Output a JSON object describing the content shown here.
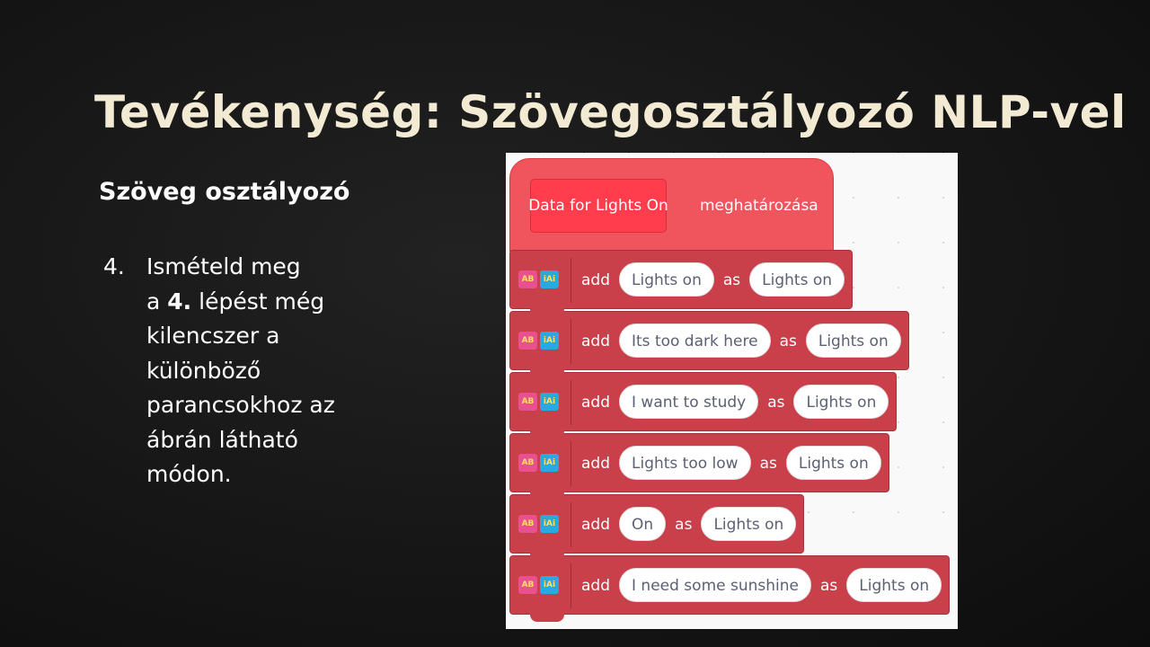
{
  "slide": {
    "title": "Tevékenység: Szövegosztályozó NLP-vel",
    "subtitle": "Szöveg osztályozó",
    "step_number": "4.",
    "step_lines": [
      "Ismételd meg",
      "a ",
      "4.",
      " lépést  még",
      "kilencszer a",
      "különböző",
      "parancsokhoz az",
      "ábrán látható",
      "módon."
    ]
  },
  "blocks": {
    "hat": {
      "data_label": "Data for Lights On",
      "text": "meghatározása"
    },
    "icon_labels": {
      "icon1": "AB",
      "icon2": "iAi"
    },
    "add_label": "add",
    "as_label": "as",
    "rows": [
      {
        "text": "Lights on",
        "class": "Lights on"
      },
      {
        "text": "Its too dark here",
        "class": "Lights on"
      },
      {
        "text": "I want to study",
        "class": "Lights on"
      },
      {
        "text": "Lights too low",
        "class": "Lights on"
      },
      {
        "text": "On",
        "class": "Lights on"
      },
      {
        "text": "I need some sunshine",
        "class": "Lights on"
      }
    ]
  },
  "colors": {
    "title": "#f2ead3",
    "hat_block": "#f0545c",
    "stack_block": "#c9404b",
    "data_reporter": "#ff3d4d"
  }
}
